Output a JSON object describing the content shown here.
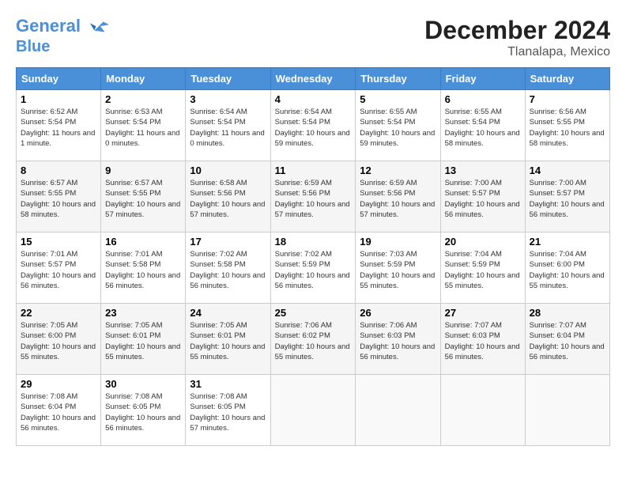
{
  "header": {
    "logo_line1": "General",
    "logo_line2": "Blue",
    "month": "December 2024",
    "location": "Tlanalapa, Mexico"
  },
  "days_of_week": [
    "Sunday",
    "Monday",
    "Tuesday",
    "Wednesday",
    "Thursday",
    "Friday",
    "Saturday"
  ],
  "weeks": [
    [
      {
        "day": "1",
        "sunrise": "6:52 AM",
        "sunset": "5:54 PM",
        "daylight": "11 hours and 1 minute."
      },
      {
        "day": "2",
        "sunrise": "6:53 AM",
        "sunset": "5:54 PM",
        "daylight": "11 hours and 0 minutes."
      },
      {
        "day": "3",
        "sunrise": "6:54 AM",
        "sunset": "5:54 PM",
        "daylight": "11 hours and 0 minutes."
      },
      {
        "day": "4",
        "sunrise": "6:54 AM",
        "sunset": "5:54 PM",
        "daylight": "10 hours and 59 minutes."
      },
      {
        "day": "5",
        "sunrise": "6:55 AM",
        "sunset": "5:54 PM",
        "daylight": "10 hours and 59 minutes."
      },
      {
        "day": "6",
        "sunrise": "6:55 AM",
        "sunset": "5:54 PM",
        "daylight": "10 hours and 58 minutes."
      },
      {
        "day": "7",
        "sunrise": "6:56 AM",
        "sunset": "5:55 PM",
        "daylight": "10 hours and 58 minutes."
      }
    ],
    [
      {
        "day": "8",
        "sunrise": "6:57 AM",
        "sunset": "5:55 PM",
        "daylight": "10 hours and 58 minutes."
      },
      {
        "day": "9",
        "sunrise": "6:57 AM",
        "sunset": "5:55 PM",
        "daylight": "10 hours and 57 minutes."
      },
      {
        "day": "10",
        "sunrise": "6:58 AM",
        "sunset": "5:56 PM",
        "daylight": "10 hours and 57 minutes."
      },
      {
        "day": "11",
        "sunrise": "6:59 AM",
        "sunset": "5:56 PM",
        "daylight": "10 hours and 57 minutes."
      },
      {
        "day": "12",
        "sunrise": "6:59 AM",
        "sunset": "5:56 PM",
        "daylight": "10 hours and 57 minutes."
      },
      {
        "day": "13",
        "sunrise": "7:00 AM",
        "sunset": "5:57 PM",
        "daylight": "10 hours and 56 minutes."
      },
      {
        "day": "14",
        "sunrise": "7:00 AM",
        "sunset": "5:57 PM",
        "daylight": "10 hours and 56 minutes."
      }
    ],
    [
      {
        "day": "15",
        "sunrise": "7:01 AM",
        "sunset": "5:57 PM",
        "daylight": "10 hours and 56 minutes."
      },
      {
        "day": "16",
        "sunrise": "7:01 AM",
        "sunset": "5:58 PM",
        "daylight": "10 hours and 56 minutes."
      },
      {
        "day": "17",
        "sunrise": "7:02 AM",
        "sunset": "5:58 PM",
        "daylight": "10 hours and 56 minutes."
      },
      {
        "day": "18",
        "sunrise": "7:02 AM",
        "sunset": "5:59 PM",
        "daylight": "10 hours and 56 minutes."
      },
      {
        "day": "19",
        "sunrise": "7:03 AM",
        "sunset": "5:59 PM",
        "daylight": "10 hours and 55 minutes."
      },
      {
        "day": "20",
        "sunrise": "7:04 AM",
        "sunset": "5:59 PM",
        "daylight": "10 hours and 55 minutes."
      },
      {
        "day": "21",
        "sunrise": "7:04 AM",
        "sunset": "6:00 PM",
        "daylight": "10 hours and 55 minutes."
      }
    ],
    [
      {
        "day": "22",
        "sunrise": "7:05 AM",
        "sunset": "6:00 PM",
        "daylight": "10 hours and 55 minutes."
      },
      {
        "day": "23",
        "sunrise": "7:05 AM",
        "sunset": "6:01 PM",
        "daylight": "10 hours and 55 minutes."
      },
      {
        "day": "24",
        "sunrise": "7:05 AM",
        "sunset": "6:01 PM",
        "daylight": "10 hours and 55 minutes."
      },
      {
        "day": "25",
        "sunrise": "7:06 AM",
        "sunset": "6:02 PM",
        "daylight": "10 hours and 55 minutes."
      },
      {
        "day": "26",
        "sunrise": "7:06 AM",
        "sunset": "6:03 PM",
        "daylight": "10 hours and 56 minutes."
      },
      {
        "day": "27",
        "sunrise": "7:07 AM",
        "sunset": "6:03 PM",
        "daylight": "10 hours and 56 minutes."
      },
      {
        "day": "28",
        "sunrise": "7:07 AM",
        "sunset": "6:04 PM",
        "daylight": "10 hours and 56 minutes."
      }
    ],
    [
      {
        "day": "29",
        "sunrise": "7:08 AM",
        "sunset": "6:04 PM",
        "daylight": "10 hours and 56 minutes."
      },
      {
        "day": "30",
        "sunrise": "7:08 AM",
        "sunset": "6:05 PM",
        "daylight": "10 hours and 56 minutes."
      },
      {
        "day": "31",
        "sunrise": "7:08 AM",
        "sunset": "6:05 PM",
        "daylight": "10 hours and 57 minutes."
      },
      null,
      null,
      null,
      null
    ]
  ]
}
